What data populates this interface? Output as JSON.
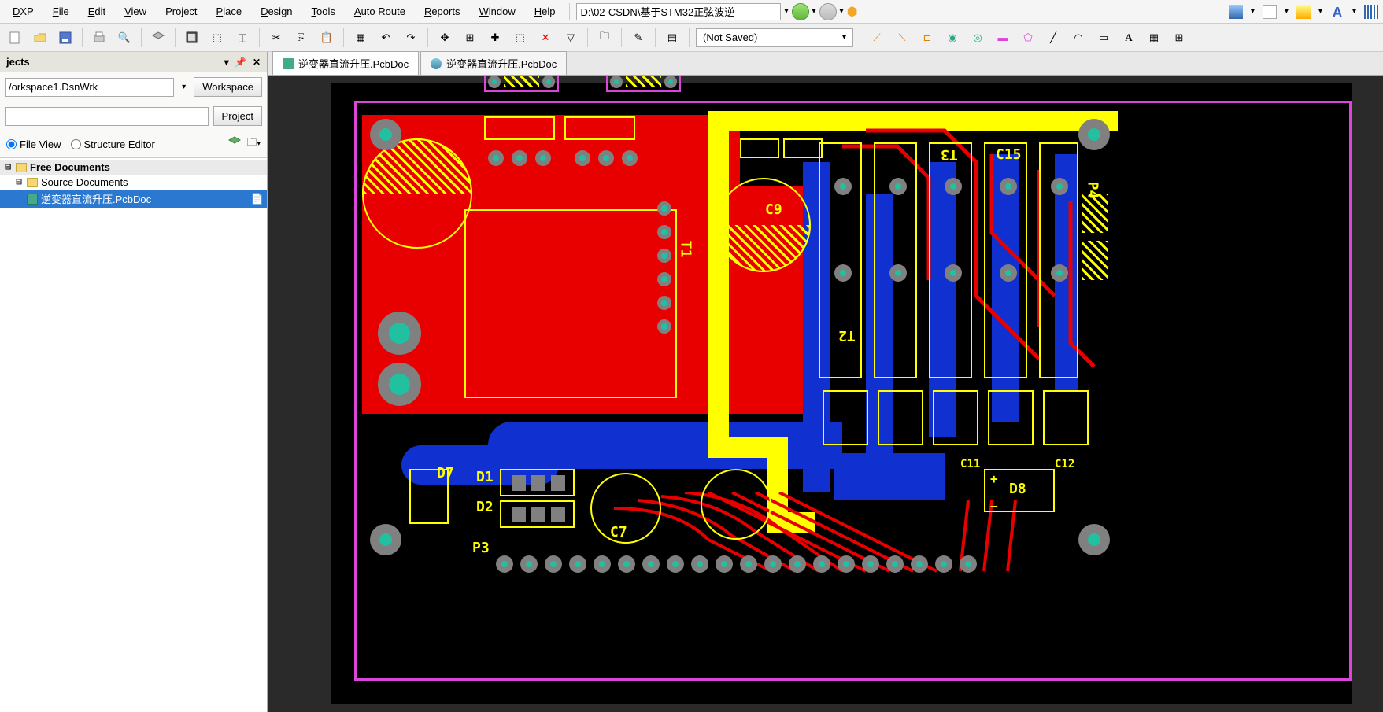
{
  "menu": {
    "items": [
      "DXP",
      "File",
      "Edit",
      "View",
      "Project",
      "Place",
      "Design",
      "Tools",
      "Auto Route",
      "Reports",
      "Window",
      "Help"
    ],
    "path": "D:\\02-CSDN\\基于STM32正弦波逆",
    "not_saved": "(Not Saved)"
  },
  "projects": {
    "title": "jects",
    "workspace": "/orkspace1.DsnWrk",
    "workspace_btn": "Workspace",
    "project_btn": "Project",
    "file_view": "File View",
    "structure_editor": "Structure Editor",
    "tree": {
      "root": "Free Documents",
      "source": "Source Documents",
      "doc": "逆变器直流升压.PcbDoc"
    }
  },
  "tabs": [
    {
      "label": "逆变器直流升压.PcbDoc",
      "active": true
    },
    {
      "label": "逆变器直流升压.PcbDoc",
      "active": false
    }
  ],
  "designators": {
    "d7": "D7",
    "d1": "D1",
    "d2": "D2",
    "c7": "C7",
    "p3": "P3",
    "c9": "C9",
    "t1": "T1",
    "t2": "T2",
    "t3": "T3",
    "c15": "C15",
    "p4": "P4",
    "d8": "D8",
    "c11": "C11",
    "c12": "C12"
  }
}
